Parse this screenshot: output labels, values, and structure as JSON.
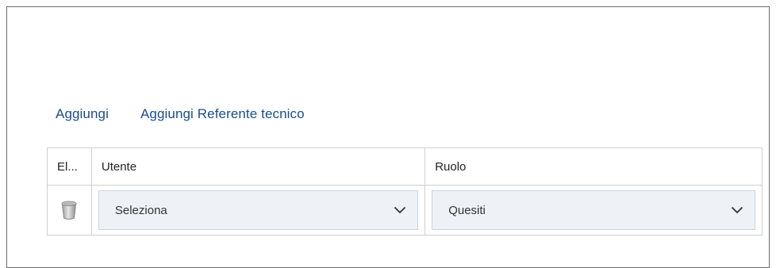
{
  "actions": {
    "add_label": "Aggiungi",
    "add_tech_contact_label": "Aggiungi Referente tecnico"
  },
  "table": {
    "columns": [
      "El...",
      "Utente",
      "Ruolo"
    ],
    "rows": [
      {
        "delete_icon": "trash-icon",
        "user_select_value": "Seleziona",
        "role_select_value": "Quesiti"
      }
    ]
  },
  "colors": {
    "link": "#1a4d8f",
    "select_bg": "#eef2f7",
    "border": "#cfcfcf"
  }
}
